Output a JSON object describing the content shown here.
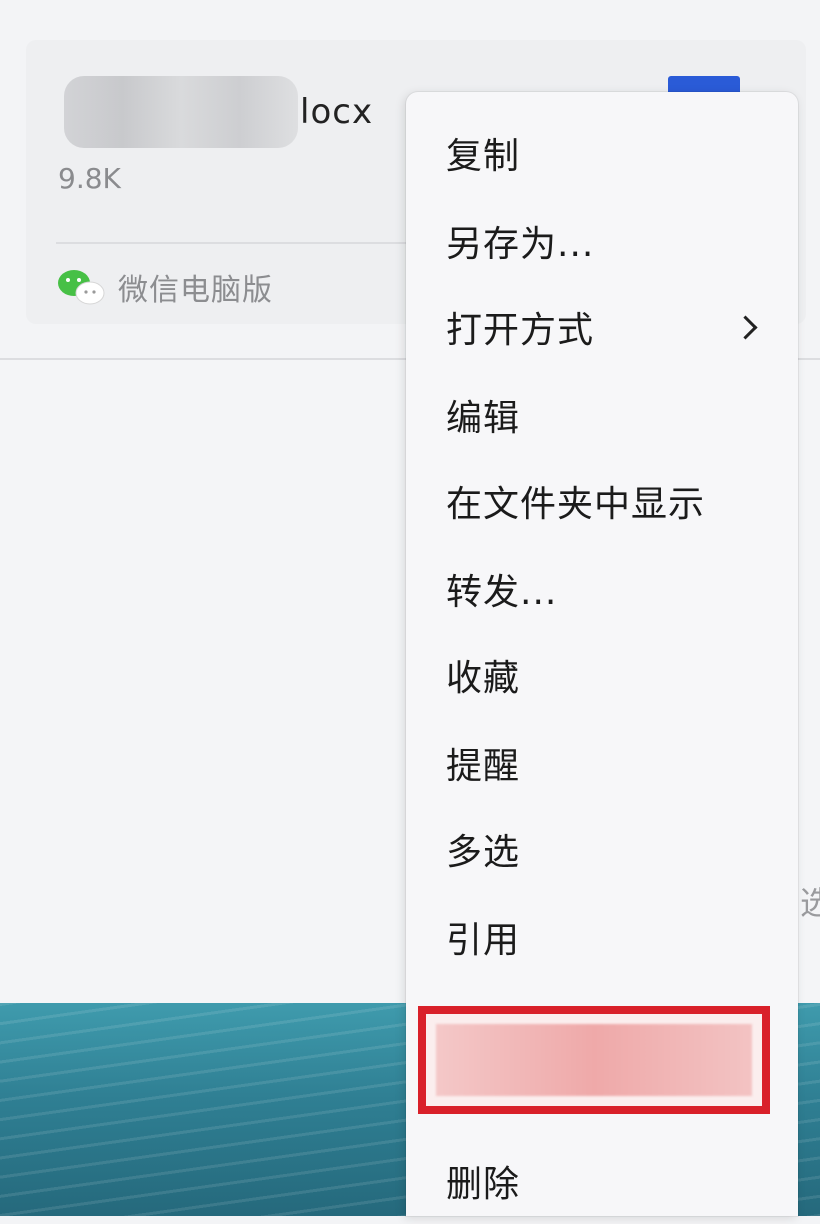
{
  "file_card": {
    "file_name_suffix": "locx",
    "file_size": "9.8K",
    "source_label": "微信电脑版"
  },
  "context_menu": {
    "items": [
      {
        "label": "复制",
        "has_submenu": false
      },
      {
        "label": "另存为...",
        "has_submenu": false
      },
      {
        "label": "打开方式",
        "has_submenu": true
      },
      {
        "label": "编辑",
        "has_submenu": false
      },
      {
        "label": "在文件夹中显示",
        "has_submenu": false
      },
      {
        "label": "转发...",
        "has_submenu": false
      },
      {
        "label": "收藏",
        "has_submenu": false
      },
      {
        "label": "提醒",
        "has_submenu": false
      },
      {
        "label": "多选",
        "has_submenu": false
      },
      {
        "label": "引用",
        "has_submenu": false
      },
      {
        "label": "删除",
        "has_submenu": false
      }
    ]
  },
  "peek_text": "选",
  "colors": {
    "highlight_border": "#d9202a",
    "wechat_green": "#47c046",
    "doc_blue": "#2a5bd7"
  }
}
